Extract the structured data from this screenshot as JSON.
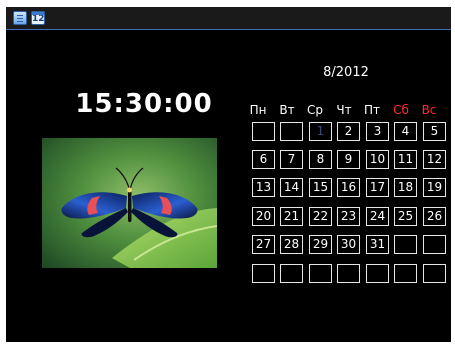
{
  "topbar": {
    "icons": [
      "notepad-icon",
      "calendar-icon"
    ],
    "calendar_icon_text": "12"
  },
  "clock": {
    "time": "15:30:00"
  },
  "photo": {
    "subject": "butterfly-photo"
  },
  "calendar": {
    "month_label": "8/2012",
    "weekdays": [
      "Пн",
      "Вт",
      "Ср",
      "Чт",
      "Пт",
      "Сб",
      "Вс"
    ],
    "weekend_color": "#ff2a2a",
    "weeks": [
      [
        "",
        "",
        "1",
        "2",
        "3",
        "4",
        "5"
      ],
      [
        "6",
        "7",
        "8",
        "9",
        "10",
        "11",
        "12"
      ],
      [
        "13",
        "14",
        "15",
        "16",
        "17",
        "18",
        "19"
      ],
      [
        "20",
        "21",
        "22",
        "23",
        "24",
        "25",
        "26"
      ],
      [
        "27",
        "28",
        "29",
        "30",
        "31",
        "",
        ""
      ],
      [
        "",
        "",
        "",
        "",
        "",
        "",
        ""
      ]
    ]
  },
  "colors": {
    "background": "#000000",
    "text": "#ffffff",
    "weekend": "#ff2a2a",
    "day_1": "#3a4a7a",
    "topbar_accent": "#3f6fb4"
  }
}
